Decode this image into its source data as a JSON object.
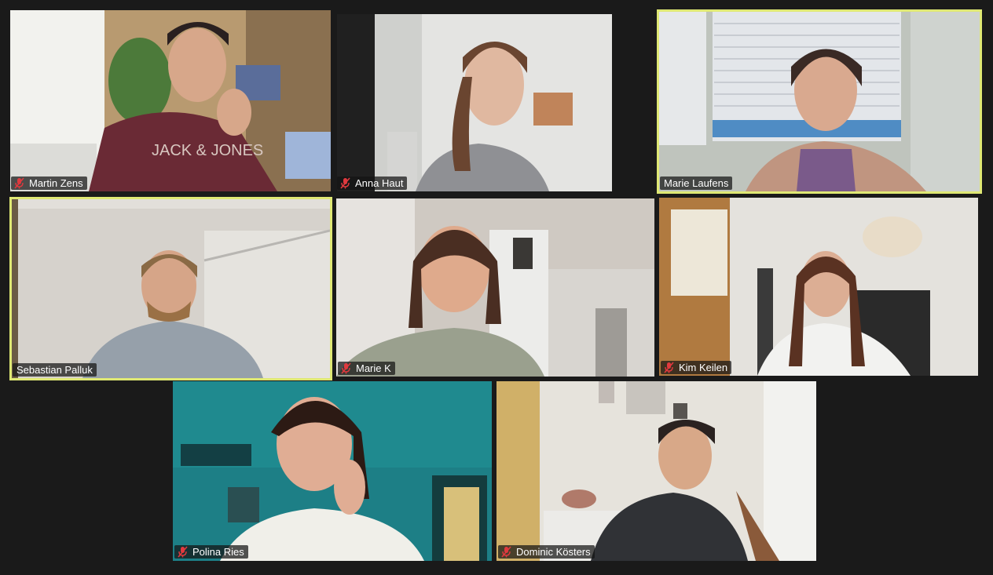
{
  "participants": [
    {
      "name": "Martin Zens",
      "muted": true,
      "speaking": false
    },
    {
      "name": "Anna Haut",
      "muted": true,
      "speaking": false
    },
    {
      "name": "Marie Laufens",
      "muted": false,
      "speaking": true
    },
    {
      "name": "Sebastian Palluk",
      "muted": false,
      "speaking": true
    },
    {
      "name": "Marie K",
      "muted": true,
      "speaking": false
    },
    {
      "name": "Kim Keilen",
      "muted": true,
      "speaking": false
    },
    {
      "name": "Polina Ries",
      "muted": true,
      "speaking": false
    },
    {
      "name": "Dominic Kösters",
      "muted": true,
      "speaking": false
    }
  ],
  "colors": {
    "background": "#1a1a1a",
    "active_speaker_border": "#dfe874",
    "mute_icon": "#e0393e"
  },
  "icons": {
    "mute": "microphone-muted-icon"
  }
}
